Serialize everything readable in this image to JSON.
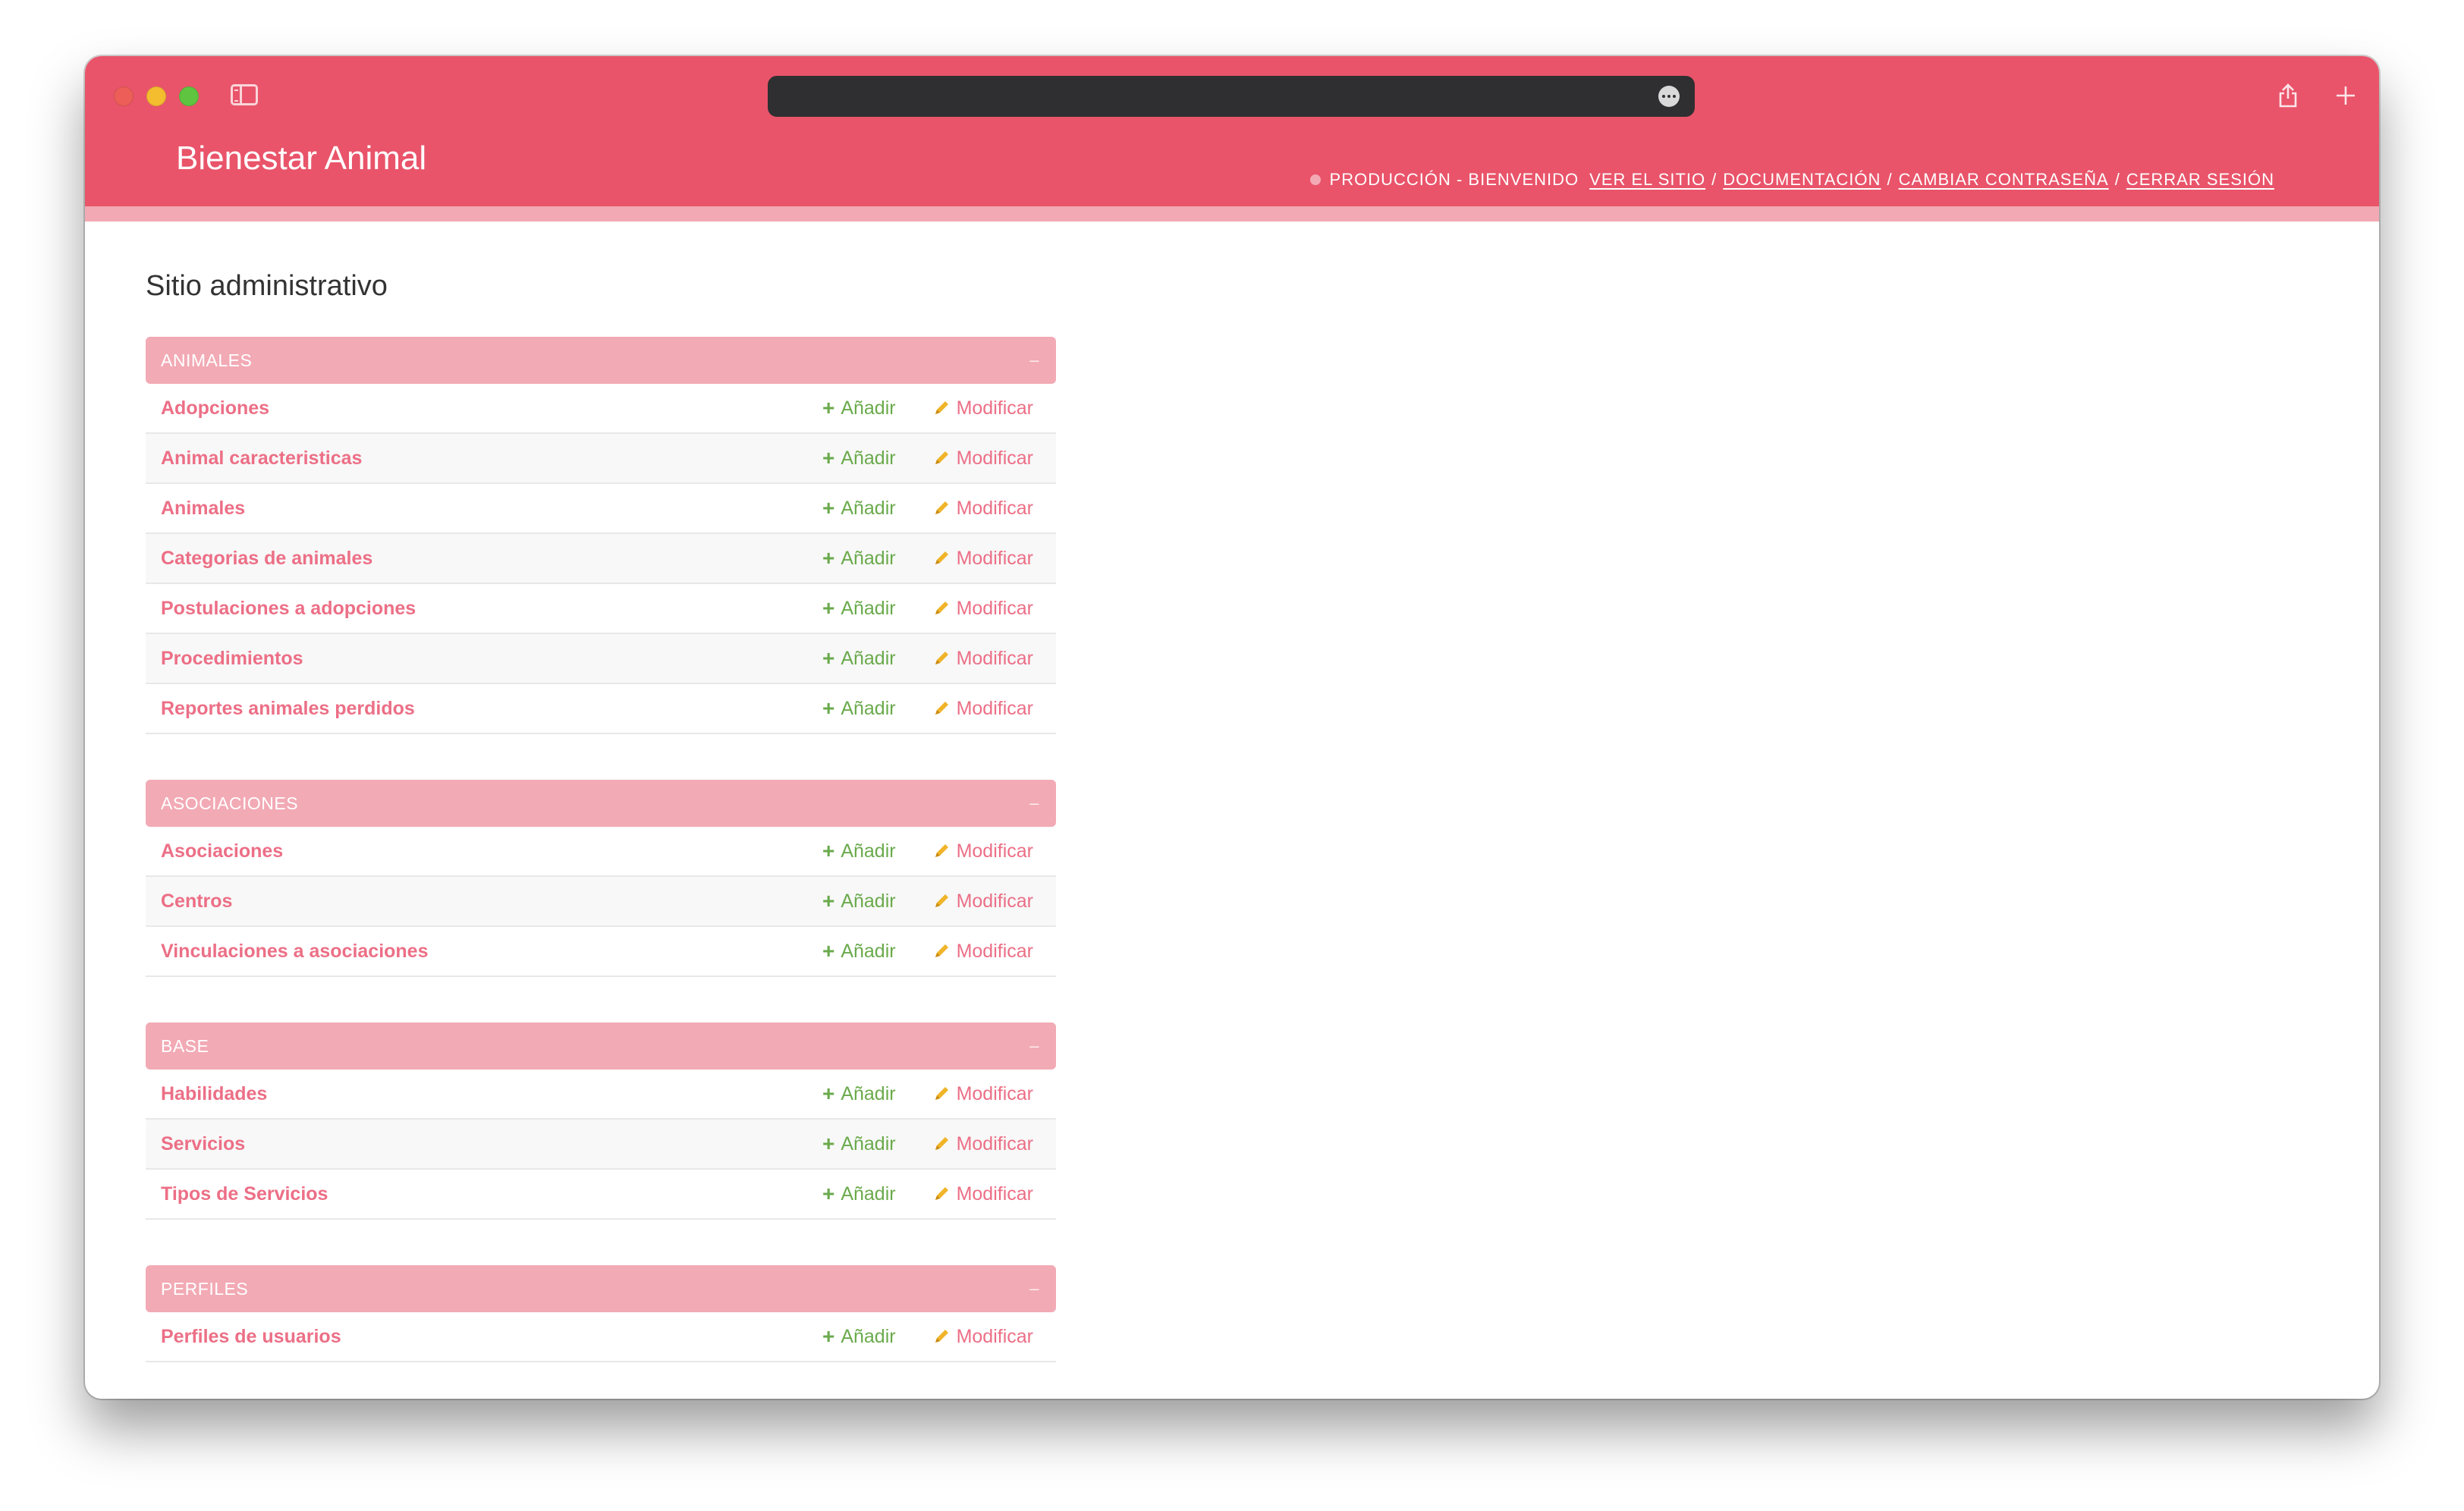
{
  "header": {
    "site_title": "Bienestar Animal",
    "welcome": "PRODUCCIÓN - BIENVENIDO",
    "links": {
      "view_site": "VER EL SITIO",
      "documentation": "DOCUMENTACIÓN",
      "change_password": "CAMBIAR CONTRASEÑA",
      "logout": "CERRAR SESIÓN"
    },
    "separator": "/"
  },
  "content": {
    "title": "Sitio administrativo"
  },
  "actions": {
    "add": "Añadir",
    "change": "Modificar",
    "collapse": "–"
  },
  "modules": [
    {
      "caption": "ANIMALES",
      "models": [
        {
          "name": "Adopciones"
        },
        {
          "name": "Animal caracteristicas"
        },
        {
          "name": "Animales"
        },
        {
          "name": "Categorias de animales"
        },
        {
          "name": "Postulaciones a adopciones"
        },
        {
          "name": "Procedimientos"
        },
        {
          "name": "Reportes animales perdidos"
        }
      ]
    },
    {
      "caption": "ASOCIACIONES",
      "models": [
        {
          "name": "Asociaciones"
        },
        {
          "name": "Centros"
        },
        {
          "name": "Vinculaciones a asociaciones"
        }
      ]
    },
    {
      "caption": "BASE",
      "models": [
        {
          "name": "Habilidades"
        },
        {
          "name": "Servicios"
        },
        {
          "name": "Tipos de Servicios"
        }
      ]
    },
    {
      "caption": "PERFILES",
      "models": [
        {
          "name": "Perfiles de usuarios"
        }
      ]
    }
  ],
  "colors": {
    "brand": "#e9546a",
    "caption": "#f2aab5",
    "link": "#ec6f86",
    "add": "#6aaa4c",
    "change_icon": "#f0b429"
  },
  "icons": [
    "sidebar-toggle-icon",
    "more-icon",
    "share-icon",
    "new-tab-icon",
    "tabs-overview-icon",
    "plus-icon",
    "pencil-icon"
  ]
}
